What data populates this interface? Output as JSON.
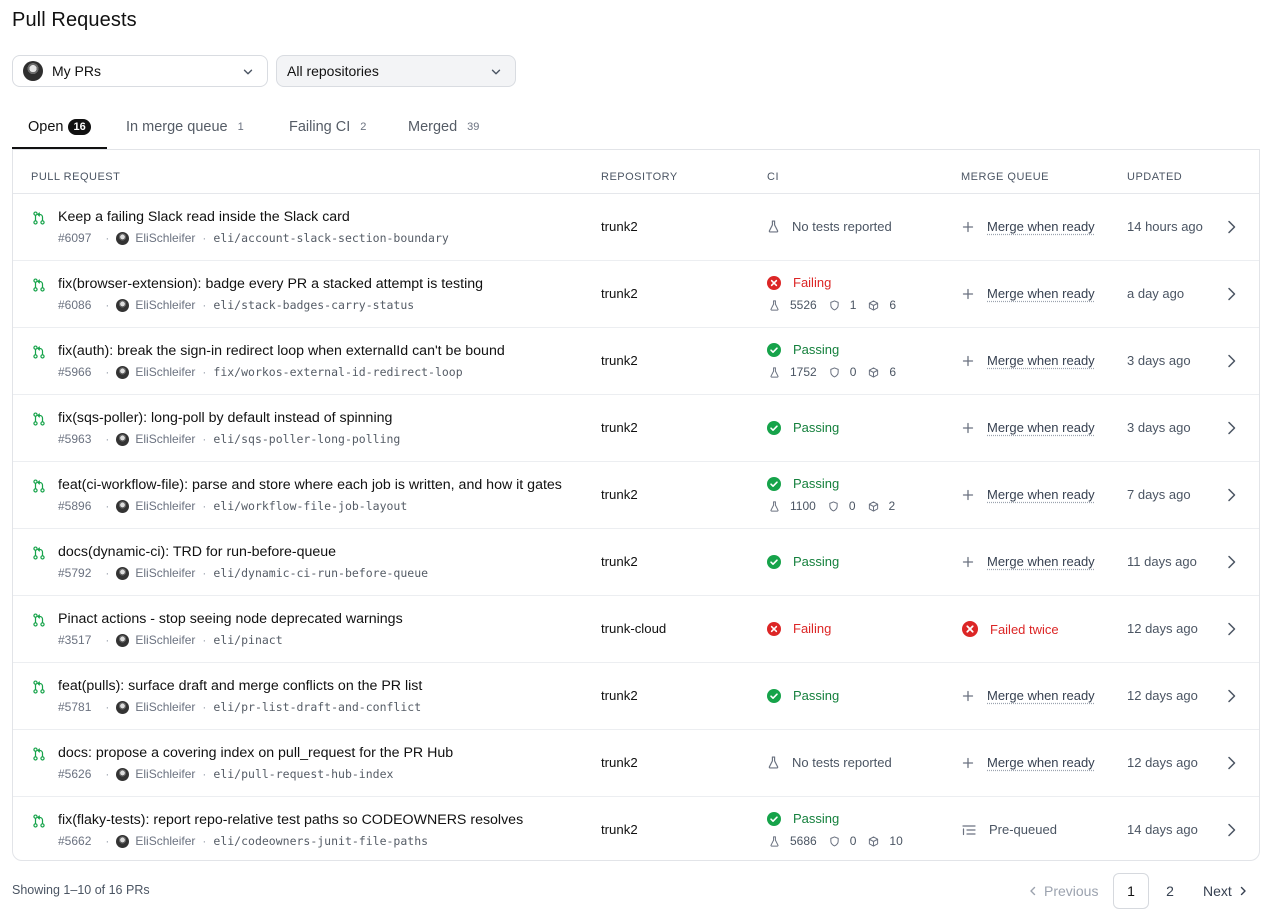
{
  "page": {
    "title": "Pull Requests"
  },
  "filters": {
    "author": {
      "label": "My PRs"
    },
    "repository": {
      "label": "All repositories"
    }
  },
  "tabs": [
    {
      "label": "Open",
      "count": "16",
      "active": true
    },
    {
      "label": "In merge queue",
      "count": "1"
    },
    {
      "label": "Failing CI",
      "count": "2"
    },
    {
      "label": "Merged",
      "count": "39"
    }
  ],
  "columns": {
    "pull_request": "PULL REQUEST",
    "repository": "REPOSITORY",
    "ci": "CI",
    "merge_queue": "MERGE QUEUE",
    "updated": "UPDATED"
  },
  "rows": [
    {
      "title": "Keep a failing Slack read inside the Slack card",
      "number": "#6097",
      "author": "EliSchleifer",
      "branch": "eli/account-slack-section-boundary",
      "repo": "trunk2",
      "ci_status": "none",
      "ci_label": "No tests reported",
      "mq": "Merge when ready",
      "updated": "14 hours ago"
    },
    {
      "title": "fix(browser-extension): badge every PR a stacked attempt is testing",
      "number": "#6086",
      "author": "EliSchleifer",
      "branch": "eli/stack-badges-carry-status",
      "repo": "trunk2",
      "ci_status": "fail",
      "ci_label": "Failing",
      "stats": {
        "tests": "5526",
        "checks": "1",
        "jobs": "6"
      },
      "mq": "Merge when ready",
      "updated": "a day ago"
    },
    {
      "title": "fix(auth): break the sign-in redirect loop when externalId can't be bound",
      "number": "#5966",
      "author": "EliSchleifer",
      "branch": "fix/workos-external-id-redirect-loop",
      "repo": "trunk2",
      "ci_status": "pass",
      "ci_label": "Passing",
      "stats": {
        "tests": "1752",
        "checks": "0",
        "jobs": "6"
      },
      "mq": "Merge when ready",
      "updated": "3 days ago"
    },
    {
      "title": "fix(sqs-poller): long-poll by default instead of spinning",
      "number": "#5963",
      "author": "EliSchleifer",
      "branch": "eli/sqs-poller-long-polling",
      "repo": "trunk2",
      "ci_status": "pass",
      "ci_label": "Passing",
      "mq": "Merge when ready",
      "updated": "3 days ago"
    },
    {
      "title": "feat(ci-workflow-file): parse and store where each job is written, and how it gates",
      "number": "#5896",
      "author": "EliSchleifer",
      "branch": "eli/workflow-file-job-layout",
      "repo": "trunk2",
      "ci_status": "pass",
      "ci_label": "Passing",
      "stats": {
        "tests": "1100",
        "checks": "0",
        "jobs": "2"
      },
      "mq": "Merge when ready",
      "updated": "7 days ago"
    },
    {
      "title": "docs(dynamic-ci): TRD for run-before-queue",
      "number": "#5792",
      "author": "EliSchleifer",
      "branch": "eli/dynamic-ci-run-before-queue",
      "repo": "trunk2",
      "ci_status": "pass",
      "ci_label": "Passing",
      "mq": "Merge when ready",
      "updated": "11 days ago"
    },
    {
      "title": "Pinact actions - stop seeing node deprecated warnings",
      "number": "#3517",
      "author": "EliSchleifer",
      "branch": "eli/pinact",
      "repo": "trunk-cloud",
      "ci_status": "fail",
      "ci_label": "Failing",
      "mq": "Failed twice",
      "mq_status": "fail",
      "updated": "12 days ago"
    },
    {
      "title": "feat(pulls): surface draft and merge conflicts on the PR list",
      "number": "#5781",
      "author": "EliSchleifer",
      "branch": "eli/pr-list-draft-and-conflict",
      "repo": "trunk2",
      "ci_status": "pass",
      "ci_label": "Passing",
      "mq": "Merge when ready",
      "updated": "12 days ago"
    },
    {
      "title": "docs: propose a covering index on pull_request for the PR Hub",
      "number": "#5626",
      "author": "EliSchleifer",
      "branch": "eli/pull-request-hub-index",
      "repo": "trunk2",
      "ci_status": "none",
      "ci_label": "No tests reported",
      "mq": "Merge when ready",
      "updated": "12 days ago"
    },
    {
      "title": "fix(flaky-tests): report repo-relative test paths so CODEOWNERS resolves",
      "number": "#5662",
      "author": "EliSchleifer",
      "branch": "eli/codeowners-junit-file-paths",
      "repo": "trunk2",
      "ci_status": "pass",
      "ci_label": "Passing",
      "stats": {
        "tests": "5686",
        "checks": "0",
        "jobs": "10"
      },
      "mq": "Pre-queued",
      "mq_status": "pre",
      "updated": "14 days ago"
    }
  ],
  "footer": {
    "showing": "Showing 1–10 of 16 PRs",
    "previous": "Previous",
    "page1": "1",
    "page2": "2",
    "next": "Next"
  },
  "colors": {
    "pass": "#15803d",
    "fail": "#dc2626",
    "icon": "#16a34a"
  },
  "icons": {
    "pr": "git-pull-request-icon",
    "chevron": "chevron-right-icon",
    "flask": "flask-icon",
    "shield": "shield-icon",
    "cube": "cube-icon",
    "plus": "plus-icon",
    "check": "check-circle-icon",
    "x": "x-circle-icon",
    "prequeue": "list-icon"
  }
}
